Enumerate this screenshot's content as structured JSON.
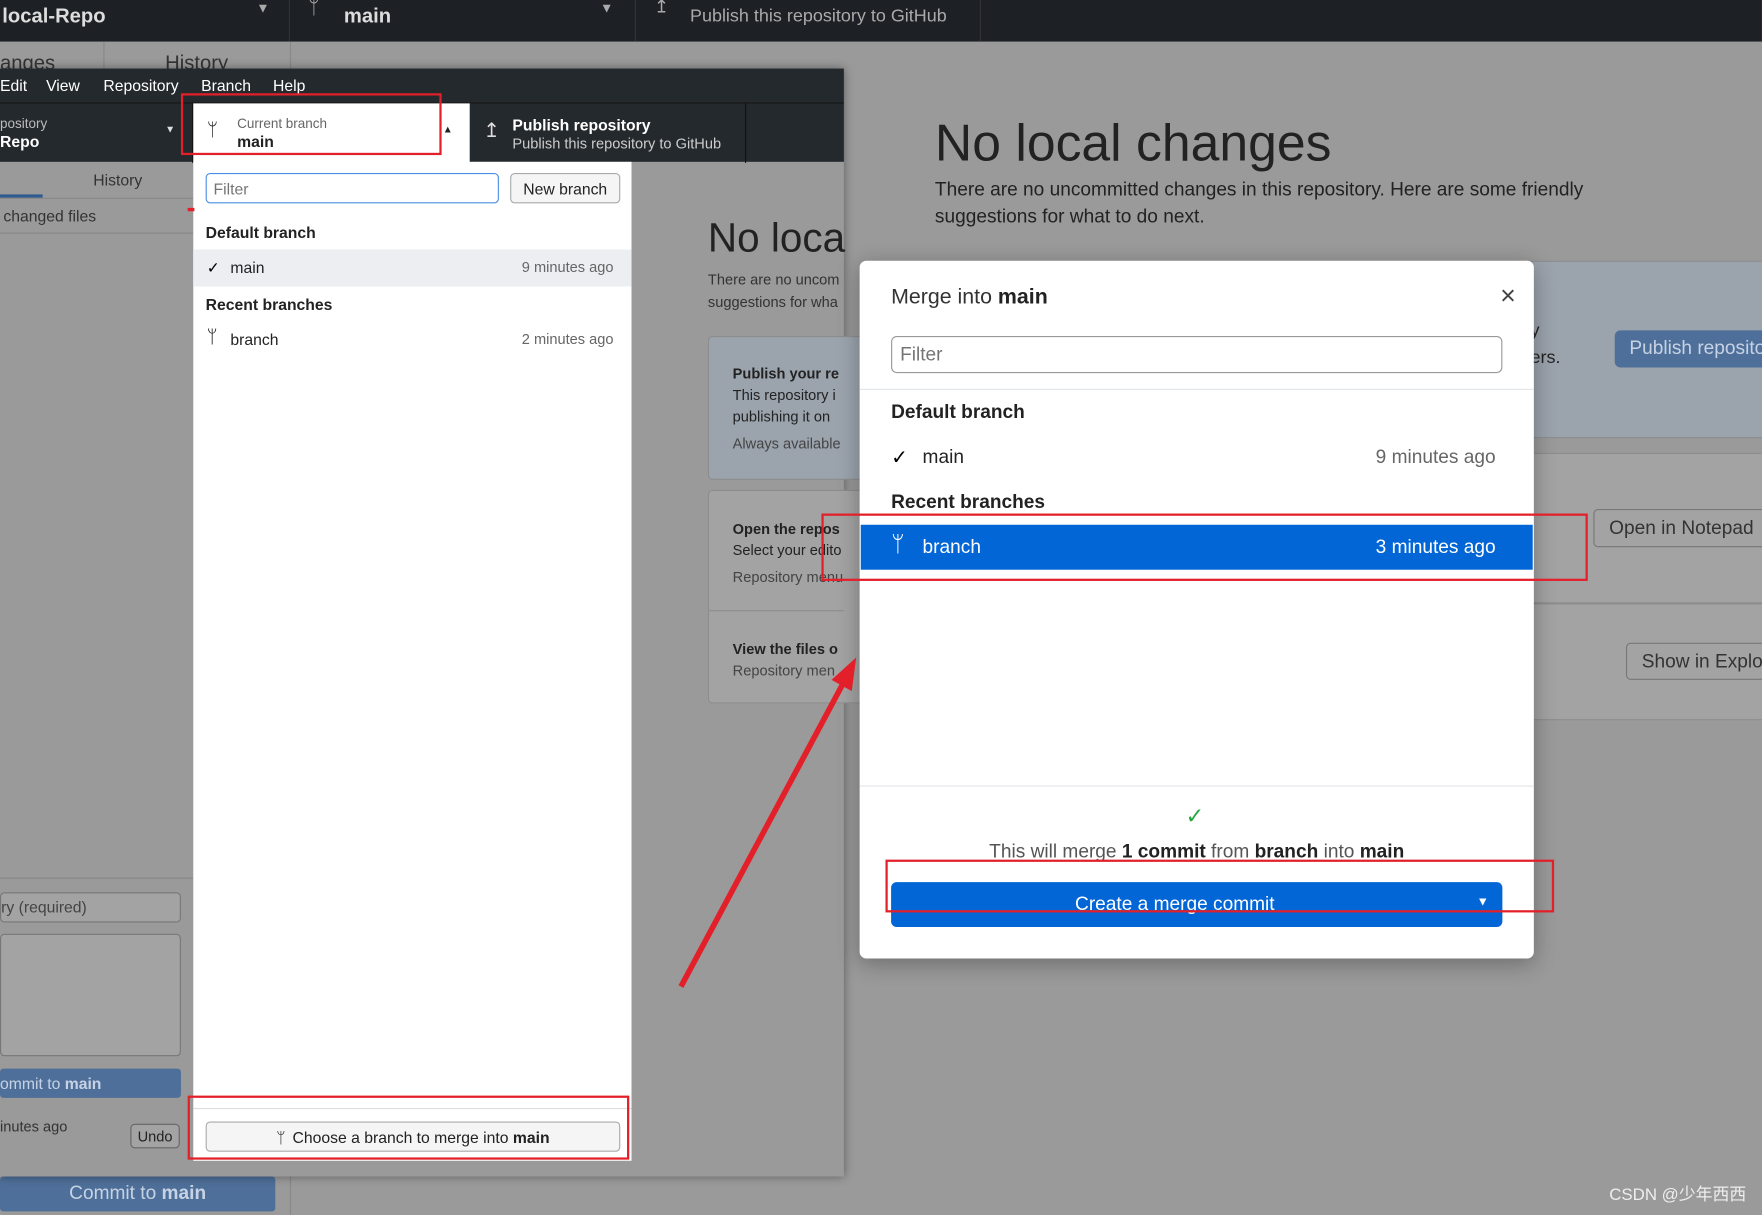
{
  "background": {
    "repo_name": "local-Repo",
    "branch_name": "main",
    "publish_sub": "Publish this repository to GitHub",
    "tab_changes": "anges",
    "tab_history": "History",
    "title": "No local changes",
    "description": "There are no uncommitted changes in this repository. Here are some friendly suggestions for what to do next.",
    "publish_button": "Publish reposito",
    "notepad_button": "Open in Notepad",
    "explorer_button": "Show in Explo",
    "card1_tail": "y",
    "card1_tail2": "ers."
  },
  "window": {
    "menu": [
      "Edit",
      "View",
      "Repository",
      "Branch",
      "Help"
    ],
    "repo_label": "pository",
    "repo_name": "Repo",
    "current_branch_label": "Current branch",
    "current_branch": "main",
    "publish_title": "Publish repository",
    "publish_sub": "Publish this repository to GitHub",
    "tab_history": "History",
    "changed_files": "changed files",
    "summary_placeholder": "ry (required)",
    "commit_button_prefix": "ommit to ",
    "commit_button_branch": "main",
    "last_commit_time": "inutes ago",
    "undo": "Undo",
    "bottom_commit_prefix": "Commit to ",
    "bottom_commit_branch": "main",
    "center": {
      "title": "No loca",
      "desc1": "There are no uncom",
      "desc2": "suggestions for wha",
      "card1_title": "Publish your re",
      "card1_l1": "This repository i",
      "card1_l2": "publishing it on",
      "card1_l3": "Always available",
      "card2_title": "Open the repos",
      "card2_l1": "Select your edito",
      "card2_l2": "Repository menu",
      "card3_title": "View the files o",
      "card3_l1": "Repository men"
    }
  },
  "branch_dropdown": {
    "filter_placeholder": "Filter",
    "new_branch": "New branch",
    "default_header": "Default branch",
    "default_branches": [
      {
        "name": "main",
        "time": "9 minutes ago",
        "checked": true
      }
    ],
    "recent_header": "Recent branches",
    "recent_branches": [
      {
        "name": "branch",
        "time": "2 minutes ago"
      }
    ],
    "merge_button_prefix": "Choose a branch to merge into ",
    "merge_button_branch": "main"
  },
  "merge_dialog": {
    "title_prefix": "Merge into ",
    "title_branch": "main",
    "filter_placeholder": "Filter",
    "default_header": "Default branch",
    "default_branches": [
      {
        "name": "main",
        "time": "9 minutes ago"
      }
    ],
    "recent_header": "Recent branches",
    "recent_branches": [
      {
        "name": "branch",
        "time": "3 minutes ago",
        "selected": true
      }
    ],
    "summary": {
      "p1": "This will merge ",
      "commits": "1 commit",
      "p2": " from ",
      "from": "branch",
      "p3": " into ",
      "into": "main"
    },
    "merge_button": "Create a merge commit"
  },
  "watermark": "CSDN @少年西西",
  "colors": {
    "accent": "#0366d6",
    "annotation": "#e3202a",
    "success": "#28a745"
  }
}
